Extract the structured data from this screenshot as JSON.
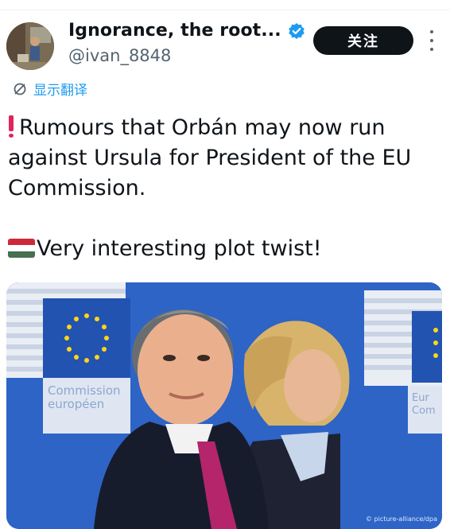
{
  "author": {
    "display_name": "Ignorance, the root...",
    "handle": "@ivan_8848",
    "verified": true,
    "avatar": "profile-photo"
  },
  "actions": {
    "follow_label": "关注",
    "more": "more-options-icon"
  },
  "translate": {
    "label": "显示翻译",
    "icon": "translate-icon"
  },
  "tweet": {
    "line1": "Rumours that Orbán may now run against Ursula for President of the EU Commission.",
    "line2": "Very interesting plot twist!",
    "emoji_1": "red-exclamation-emoji",
    "emoji_2": "hungary-flag-emoji"
  },
  "media": {
    "sign_commission": "Commission",
    "sign_europeenne": "européen",
    "sign_right_1": "Eur",
    "sign_right_2": "Com",
    "credit": "© picture-alliance/dpa"
  },
  "colors": {
    "accent": "#1d9bf0",
    "follow_bg": "#0f1419",
    "eu_blue": "#2d64c6",
    "eu_star": "#ffd617",
    "alert_red": "#e0245e"
  }
}
